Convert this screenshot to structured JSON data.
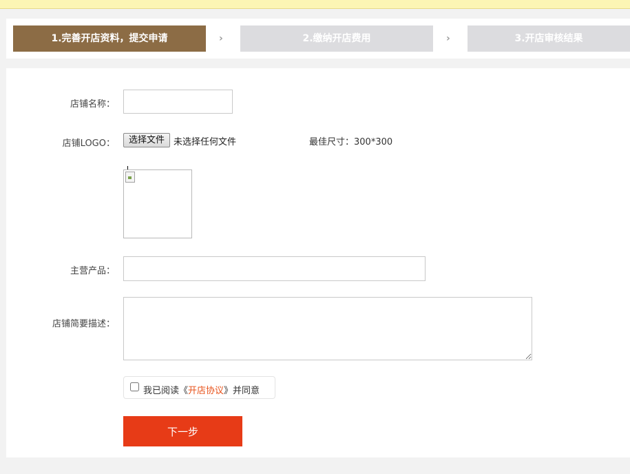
{
  "steps": [
    {
      "label": "1.完善开店资料，提交申请",
      "state": "active"
    },
    {
      "label": "2.缴纳开店费用",
      "state": "inactive"
    },
    {
      "label": "3.开店审核结果",
      "state": "inactive"
    }
  ],
  "step_separator": "›",
  "form": {
    "shop_name_label": "店铺名称：",
    "shop_name_value": "",
    "logo_label": "店铺LOGO：",
    "choose_file_label": "选择文件",
    "no_file_text": "未选择任何文件",
    "size_hint": "最佳尺寸：300*300",
    "products_label": "主营产品：",
    "products_value": "",
    "description_label": "店铺简要描述：",
    "description_value": "",
    "agree_prefix": "我已阅读《",
    "agree_link": "开店协议",
    "agree_suffix": "》并同意",
    "agree_checked": false,
    "next_label": "下一步"
  },
  "colors": {
    "active_step": "#8c6c45",
    "inactive_step": "#dcdcdf",
    "next_button": "#e73b17",
    "link": "#e8521a",
    "notice_bar": "#fcf5b4"
  }
}
